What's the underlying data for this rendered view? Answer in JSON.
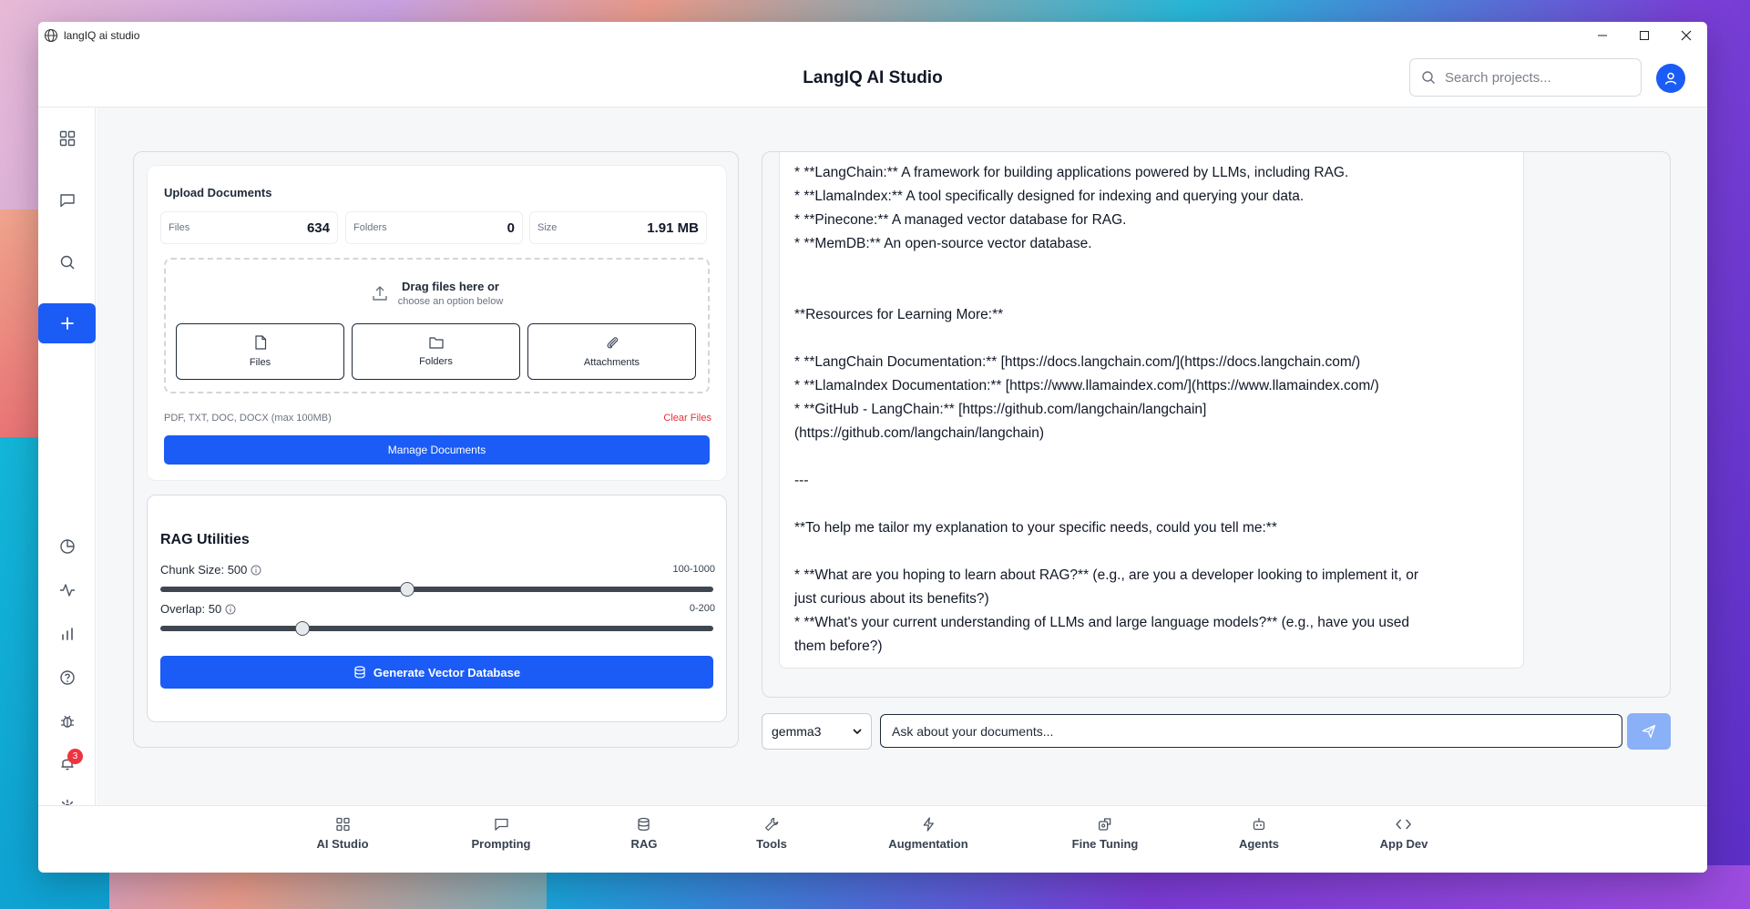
{
  "window": {
    "title": "langIQ ai studio"
  },
  "header": {
    "title": "LangIQ AI Studio",
    "search_placeholder": "Search projects..."
  },
  "sidebar": {
    "top_icons": [
      "grid-icon",
      "chat-bubble-icon",
      "search-icon",
      "plus-icon"
    ],
    "bottom_icons": [
      "pie-chart-icon",
      "activity-icon",
      "bar-chart-icon",
      "help-icon",
      "bug-icon",
      "bell-icon",
      "gear-icon"
    ],
    "notification_count": "3"
  },
  "upload": {
    "title": "Upload Documents",
    "stats": [
      {
        "label": "Files",
        "value": "634"
      },
      {
        "label": "Folders",
        "value": "0"
      },
      {
        "label": "Size",
        "value": "1.91 MB"
      }
    ],
    "drop_main": "Drag files here or",
    "drop_sub": "choose an option below",
    "buttons": [
      "Files",
      "Folders",
      "Attachments"
    ],
    "formats": "PDF, TXT, DOC, DOCX (max 100MB)",
    "clear_label": "Clear Files",
    "manage_label": "Manage Documents"
  },
  "rag": {
    "title": "RAG Utilities",
    "chunk_label": "Chunk Size: 500",
    "chunk_range": "100-1000",
    "chunk_value": 500,
    "chunk_min": 100,
    "chunk_max": 1000,
    "overlap_label": "Overlap: 50",
    "overlap_range": "0-200",
    "overlap_value": 50,
    "overlap_min": 0,
    "overlap_max": 200,
    "generate_label": "Generate Vector Database"
  },
  "chat": {
    "lines": [
      "* **LangChain:** A framework for building applications powered by LLMs, including RAG.",
      "* **LlamaIndex:** A tool specifically designed for indexing and querying your data.",
      "* **Pinecone:** A managed vector database for RAG.",
      "* **MemDB:** An open-source vector database.",
      "",
      "",
      "**Resources for Learning More:**",
      "",
      "* **LangChain Documentation:** [https://docs.langchain.com/](https://docs.langchain.com/)",
      "* **LlamaIndex Documentation:** [https://www.llamaindex.com/](https://www.llamaindex.com/)",
      "* **GitHub - LangChain:** [https://github.com/langchain/langchain]",
      "(https://github.com/langchain/langchain)",
      "",
      "---",
      "",
      "**To help me tailor my explanation to your specific needs, could you tell me:**",
      "",
      "*   **What are you hoping to learn about RAG?** (e.g., are you a developer looking to implement it, or",
      "just curious about its benefits?)",
      "*   **What's your current understanding of LLMs and large language models?** (e.g., have you used",
      "them before?)"
    ],
    "model": "gemma3",
    "input_placeholder": "Ask about your documents..."
  },
  "bottom_nav": [
    {
      "label": "AI Studio",
      "icon": "grid-icon"
    },
    {
      "label": "Prompting",
      "icon": "chat-bubble-icon"
    },
    {
      "label": "RAG",
      "icon": "database-icon"
    },
    {
      "label": "Tools",
      "icon": "wrench-icon"
    },
    {
      "label": "Augmentation",
      "icon": "lightning-icon"
    },
    {
      "label": "Fine Tuning",
      "icon": "fine-tuning-icon"
    },
    {
      "label": "Agents",
      "icon": "robot-icon"
    },
    {
      "label": "App Dev",
      "icon": "code-icon"
    }
  ],
  "colors": {
    "accent": "#1a5cf5",
    "danger": "#e5303b",
    "send_disabled": "#8ab0f7"
  }
}
